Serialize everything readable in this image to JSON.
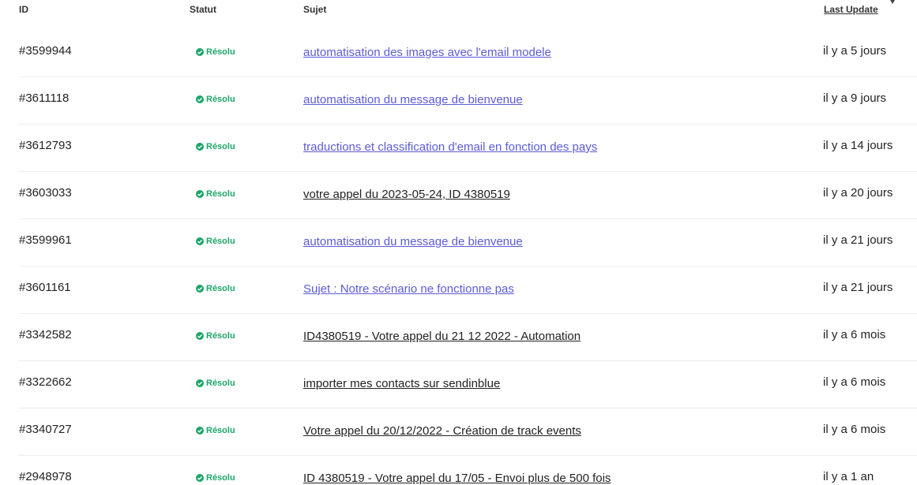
{
  "table": {
    "headers": {
      "id": "ID",
      "status": "Statut",
      "subject": "Sujet",
      "last_update": "Last Update"
    },
    "rows": [
      {
        "id": "#3599944",
        "status": "Résolu",
        "subject": "automatisation des images avec l'email modele",
        "subject_style": "visited",
        "updated": "il y a 5 jours"
      },
      {
        "id": "#3611118",
        "status": "Résolu",
        "subject": "automatisation du message de bienvenue",
        "subject_style": "visited",
        "updated": "il y a 9 jours"
      },
      {
        "id": "#3612793",
        "status": "Résolu",
        "subject": "traductions et classification d'email en fonction des pays",
        "subject_style": "visited",
        "updated": "il y a 14 jours"
      },
      {
        "id": "#3603033",
        "status": "Résolu",
        "subject": "votre appel du 2023-05-24, ID 4380519",
        "subject_style": "plain",
        "updated": "il y a 20 jours"
      },
      {
        "id": "#3599961",
        "status": "Résolu",
        "subject": "automatisation du message de bienvenue",
        "subject_style": "visited",
        "updated": "il y a 21 jours"
      },
      {
        "id": "#3601161",
        "status": "Résolu",
        "subject": "Sujet : Notre scénario ne fonctionne pas",
        "subject_style": "visited",
        "updated": "il y a 21 jours"
      },
      {
        "id": "#3342582",
        "status": "Résolu",
        "subject": "ID4380519 - Votre appel du 21 12 2022 - Automation",
        "subject_style": "plain",
        "updated": "il y a 6 mois"
      },
      {
        "id": "#3322662",
        "status": "Résolu",
        "subject": "importer mes contacts sur sendinblue",
        "subject_style": "plain",
        "updated": "il y a 6 mois"
      },
      {
        "id": "#3340727",
        "status": "Résolu",
        "subject": "Votre appel du 20/12/2022 - Création de track events",
        "subject_style": "plain",
        "updated": "il y a 6 mois"
      },
      {
        "id": "#2948978",
        "status": "Résolu",
        "subject": "ID 4380519 - Votre appel du 17/05 - Envoi plus de 500 fois",
        "subject_style": "plain",
        "updated": "il y a 1 an"
      }
    ]
  },
  "icons": {
    "status": "check-circle-icon",
    "sort": "sort-descending-icon"
  },
  "colors": {
    "status_resolved": "#1ea66a",
    "link_visited": "#5b5bd6",
    "link_default": "#222222",
    "divider": "#ececec"
  }
}
